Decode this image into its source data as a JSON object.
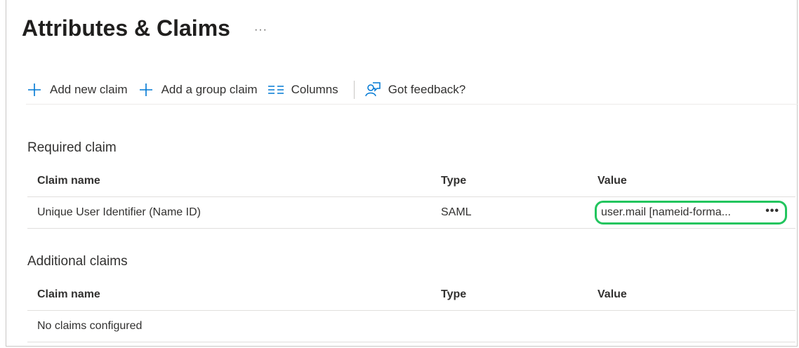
{
  "page": {
    "title": "Attributes & Claims",
    "more_label": "···"
  },
  "toolbar": {
    "add_claim": "Add new claim",
    "add_group_claim": "Add a group claim",
    "columns": "Columns",
    "feedback": "Got feedback?"
  },
  "required": {
    "title": "Required claim",
    "columns": [
      "Claim name",
      "Type",
      "Value"
    ],
    "rows": [
      {
        "name": "Unique User Identifier (Name ID)",
        "type": "SAML",
        "value": "user.mail [nameid-forma...",
        "more": "•••"
      }
    ]
  },
  "additional": {
    "title": "Additional claims",
    "columns": [
      "Claim name",
      "Type",
      "Value"
    ],
    "empty_text": "No claims configured"
  },
  "colors": {
    "accent": "#0078d4",
    "highlight": "#22c55e"
  },
  "icons": {
    "add": "plus-icon",
    "columns": "columns-icon",
    "feedback": "feedback-icon"
  }
}
